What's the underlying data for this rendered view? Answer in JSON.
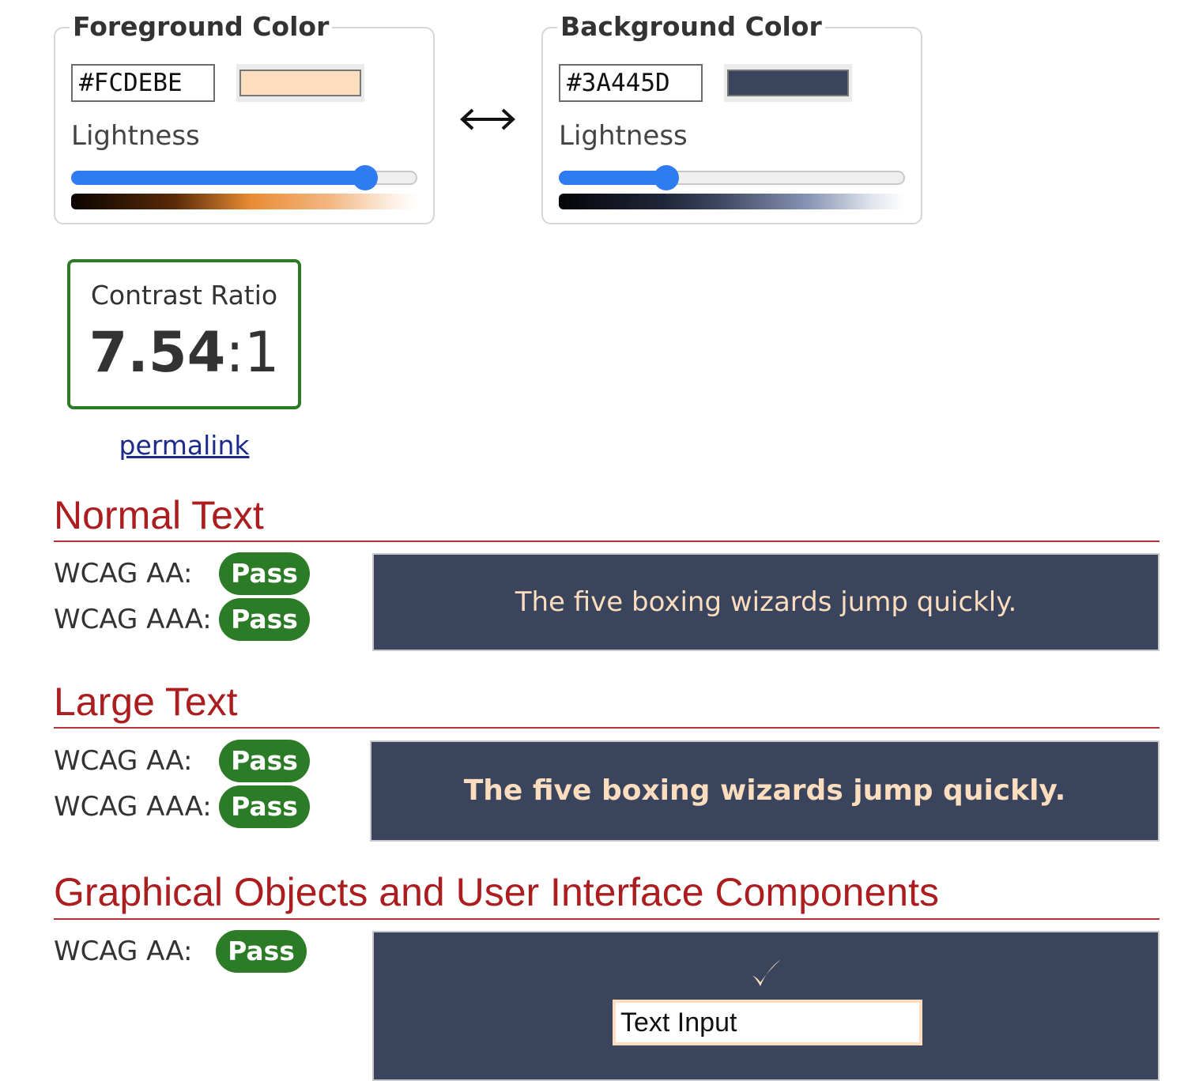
{
  "foreground": {
    "legend": "Foreground Color",
    "hex": "#FCDEBE",
    "swatch_color": "#FCDEBE",
    "lightness_label": "Lightness",
    "lightness_pct": 85
  },
  "background": {
    "legend": "Background Color",
    "hex": "#3A445D",
    "swatch_color": "#3A445D",
    "lightness_label": "Lightness",
    "lightness_pct": 31
  },
  "swap": {
    "icon": "left-right-arrow-icon"
  },
  "contrast": {
    "label": "Contrast Ratio",
    "ratio": "7.54",
    "suffix": ":1",
    "border_color": "#2C7B26"
  },
  "permalink": "permalink",
  "sections": {
    "normal": {
      "title": "Normal Text",
      "aa_label": "WCAG AA:",
      "aa_result": "Pass",
      "aaa_label": "WCAG AAA:",
      "aaa_result": "Pass",
      "sample": "The five boxing wizards jump quickly."
    },
    "large": {
      "title": "Large Text",
      "aa_label": "WCAG AA:",
      "aa_result": "Pass",
      "aaa_label": "WCAG AAA:",
      "aaa_result": "Pass",
      "sample": "The five boxing wizards jump quickly."
    },
    "graphical": {
      "title": "Graphical Objects and User Interface Components",
      "aa_label": "WCAG AA:",
      "aa_result": "Pass",
      "check_icon": "checkmark-icon",
      "input_value": "Text Input"
    }
  },
  "colors": {
    "heading": "#AC1D20",
    "pass": "#2C7B26",
    "slider": "#2F7BF2",
    "link": "#1C2B8A"
  }
}
